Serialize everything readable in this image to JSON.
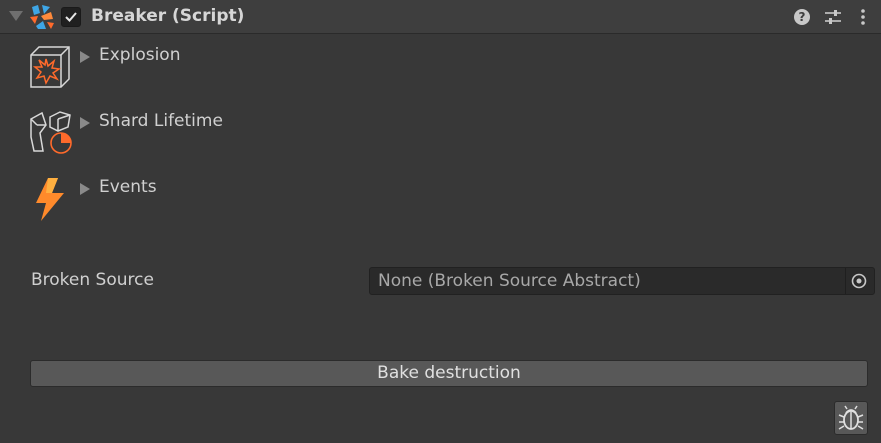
{
  "component": {
    "title": "Breaker (Script)",
    "enabled": true,
    "icon": "shatter-script-icon"
  },
  "header_buttons": [
    {
      "icon": "help-icon",
      "glyph": "?"
    },
    {
      "icon": "preset-sliders-icon"
    },
    {
      "icon": "kebab-menu-icon"
    }
  ],
  "sections": [
    {
      "label": "Explosion",
      "icon": "explosion-cube-icon",
      "expanded": false
    },
    {
      "label": "Shard Lifetime",
      "icon": "shard-lifetime-icon",
      "expanded": false
    },
    {
      "label": "Events",
      "icon": "lightning-bolt-icon",
      "expanded": false
    }
  ],
  "broken_source": {
    "label": "Broken Source",
    "value": "None (Broken Source Abstract)"
  },
  "bake_button": {
    "label": "Bake destruction"
  },
  "debug_button": {
    "icon": "bug-icon"
  },
  "colors": {
    "accent": "#ff6a2b",
    "blue_accent": "#3ea6e6",
    "background": "#383838"
  }
}
